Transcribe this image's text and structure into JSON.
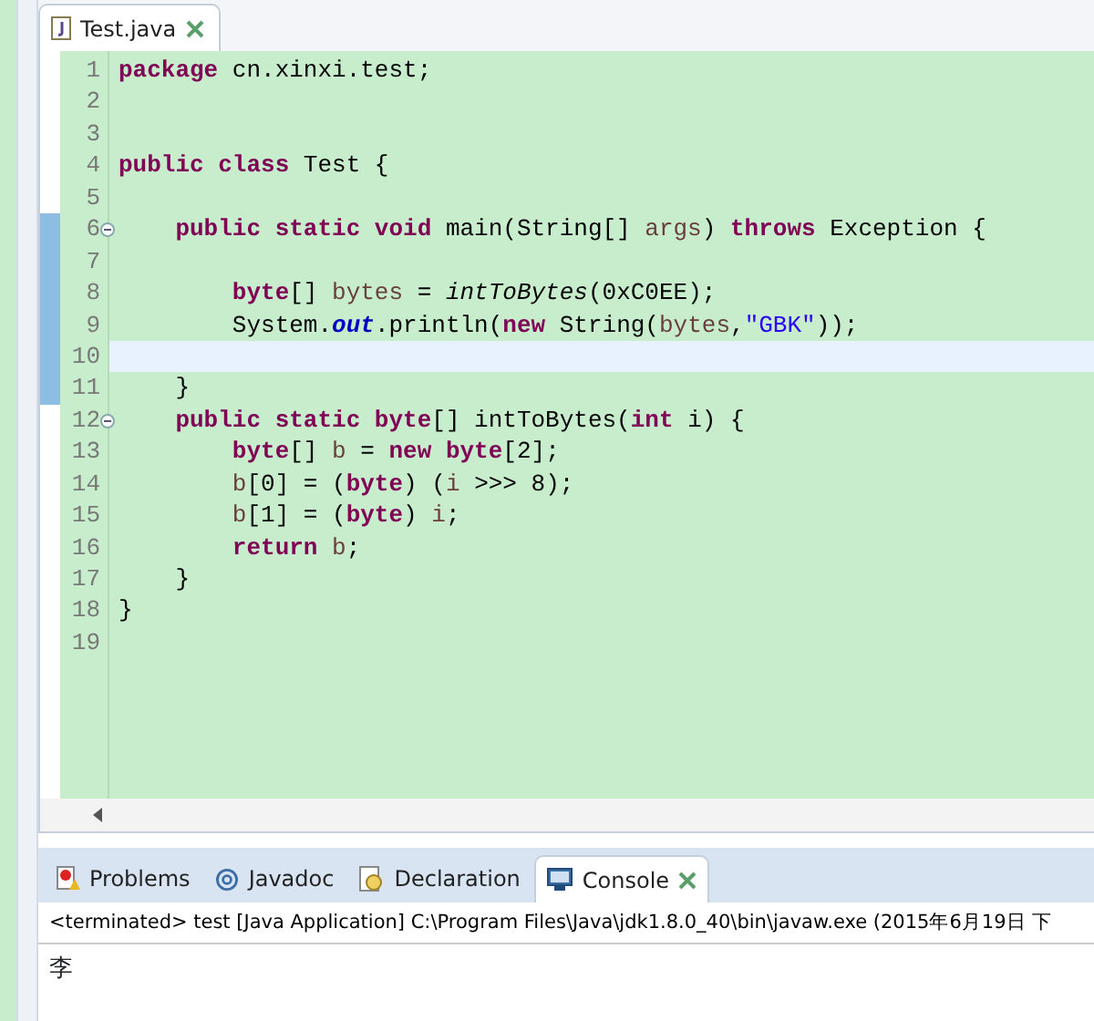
{
  "editor_tab": {
    "label": "Test.java",
    "selected": true
  },
  "lines": [
    {
      "number": "1",
      "changed": false,
      "foldable": false,
      "current": false,
      "tokens": [
        {
          "kind": "keyword",
          "text": "package "
        },
        {
          "kind": "plain",
          "text": "cn.xinxi.test;"
        }
      ]
    },
    {
      "number": "2",
      "changed": false,
      "foldable": false,
      "current": false
    },
    {
      "number": "3",
      "changed": false,
      "foldable": false,
      "current": false
    },
    {
      "number": "4",
      "changed": false,
      "foldable": false,
      "current": false,
      "tokens": [
        {
          "kind": "keyword",
          "text": "public class "
        },
        {
          "kind": "plain",
          "text": "Test {"
        }
      ]
    },
    {
      "number": "5",
      "changed": false,
      "foldable": false,
      "current": false
    },
    {
      "number": "6",
      "changed": true,
      "foldable": true,
      "current": false,
      "tokens": [
        {
          "kind": "keyword",
          "text": "    public static void "
        },
        {
          "kind": "plain",
          "text": "main(String[] "
        },
        {
          "kind": "local",
          "text": "args"
        },
        {
          "kind": "plain",
          "text": ") "
        },
        {
          "kind": "keyword",
          "text": "throws "
        },
        {
          "kind": "plain",
          "text": "Exception {"
        }
      ]
    },
    {
      "number": "7",
      "changed": true,
      "foldable": false,
      "current": false
    },
    {
      "number": "8",
      "changed": true,
      "foldable": false,
      "current": false,
      "tokens": [
        {
          "kind": "keyword",
          "text": "        byte"
        },
        {
          "kind": "plain",
          "text": "[] "
        },
        {
          "kind": "local",
          "text": "bytes"
        },
        {
          "kind": "plain",
          "text": " = "
        },
        {
          "kind": "static",
          "text": "intToBytes"
        },
        {
          "kind": "plain",
          "text": "(0xC0EE);"
        }
      ]
    },
    {
      "number": "9",
      "changed": true,
      "foldable": false,
      "current": false,
      "tokens": [
        {
          "kind": "plain",
          "text": "        System."
        },
        {
          "kind": "field",
          "text": "out"
        },
        {
          "kind": "plain",
          "text": ".println("
        },
        {
          "kind": "keyword",
          "text": "new "
        },
        {
          "kind": "plain",
          "text": "String("
        },
        {
          "kind": "local",
          "text": "bytes"
        },
        {
          "kind": "plain",
          "text": ","
        },
        {
          "kind": "string",
          "text": "\"GBK\""
        },
        {
          "kind": "plain",
          "text": "));"
        }
      ]
    },
    {
      "number": "10",
      "changed": true,
      "foldable": false,
      "current": true
    },
    {
      "number": "11",
      "changed": true,
      "foldable": false,
      "current": false,
      "tokens": [
        {
          "kind": "plain",
          "text": "    }"
        }
      ]
    },
    {
      "number": "12",
      "changed": false,
      "foldable": true,
      "current": false,
      "tokens": [
        {
          "kind": "keyword",
          "text": "    public static byte"
        },
        {
          "kind": "plain",
          "text": "[] intToBytes("
        },
        {
          "kind": "keyword",
          "text": "int "
        },
        {
          "kind": "plain",
          "text": "i) {"
        }
      ]
    },
    {
      "number": "13",
      "changed": false,
      "foldable": false,
      "current": false,
      "tokens": [
        {
          "kind": "keyword",
          "text": "        byte"
        },
        {
          "kind": "plain",
          "text": "[] "
        },
        {
          "kind": "local",
          "text": "b"
        },
        {
          "kind": "plain",
          "text": " = "
        },
        {
          "kind": "keyword",
          "text": "new byte"
        },
        {
          "kind": "plain",
          "text": "[2];"
        }
      ]
    },
    {
      "number": "14",
      "changed": false,
      "foldable": false,
      "current": false,
      "tokens": [
        {
          "kind": "local",
          "text": "        b"
        },
        {
          "kind": "plain",
          "text": "[0] = ("
        },
        {
          "kind": "keyword",
          "text": "byte"
        },
        {
          "kind": "plain",
          "text": ") ("
        },
        {
          "kind": "local",
          "text": "i"
        },
        {
          "kind": "plain",
          "text": " >>> 8);"
        }
      ]
    },
    {
      "number": "15",
      "changed": false,
      "foldable": false,
      "current": false,
      "tokens": [
        {
          "kind": "local",
          "text": "        b"
        },
        {
          "kind": "plain",
          "text": "[1] = ("
        },
        {
          "kind": "keyword",
          "text": "byte"
        },
        {
          "kind": "plain",
          "text": ") "
        },
        {
          "kind": "local",
          "text": "i"
        },
        {
          "kind": "plain",
          "text": ";"
        }
      ]
    },
    {
      "number": "16",
      "changed": false,
      "foldable": false,
      "current": false,
      "tokens": [
        {
          "kind": "keyword",
          "text": "        return "
        },
        {
          "kind": "local",
          "text": "b"
        },
        {
          "kind": "plain",
          "text": ";"
        }
      ]
    },
    {
      "number": "17",
      "changed": false,
      "foldable": false,
      "current": false,
      "tokens": [
        {
          "kind": "plain",
          "text": "    }"
        }
      ]
    },
    {
      "number": "18",
      "changed": false,
      "foldable": false,
      "current": false,
      "tokens": [
        {
          "kind": "plain",
          "text": "}"
        }
      ]
    },
    {
      "number": "19",
      "changed": false,
      "foldable": false,
      "current": false
    }
  ],
  "bottom_tabs": [
    {
      "kind": "problems",
      "label": "Problems",
      "selected": false
    },
    {
      "kind": "javadoc",
      "label": "Javadoc",
      "selected": false
    },
    {
      "kind": "declaration",
      "label": "Declaration",
      "selected": false
    },
    {
      "kind": "console",
      "label": "Console",
      "selected": true
    }
  ],
  "console": {
    "header": "<terminated> test [Java Application] C:\\Program Files\\Java\\jdk1.8.0_40\\bin\\javaw.exe (2015年6月19日 下",
    "output": "李"
  }
}
